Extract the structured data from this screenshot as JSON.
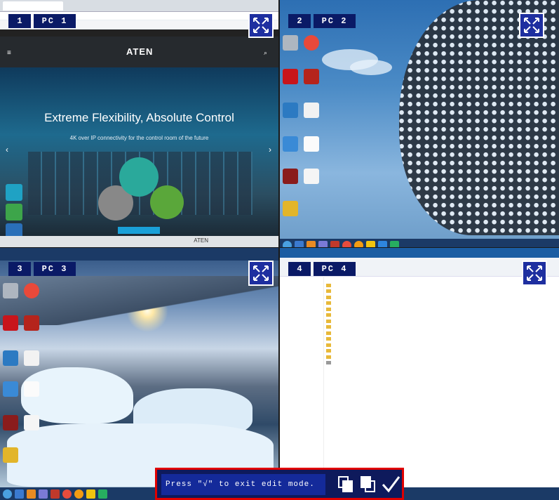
{
  "pcs": [
    {
      "num": "1",
      "name": "PC 1"
    },
    {
      "num": "2",
      "name": "PC 2"
    },
    {
      "num": "3",
      "name": "PC 3"
    },
    {
      "num": "4",
      "name": "PC 4"
    }
  ],
  "q1": {
    "logo": "ATEN",
    "hero_title": "Extreme Flexibility, Absolute Control",
    "hero_sub": "4K over IP connectivity for the control room of the future",
    "footer_logo": "ATEN"
  },
  "edit": {
    "message": "Press \"√\" to exit edit mode."
  },
  "colors": {
    "label_bg": "#0a1a66",
    "edit_border": "#e00000",
    "taskbar": "#1b3a66"
  }
}
